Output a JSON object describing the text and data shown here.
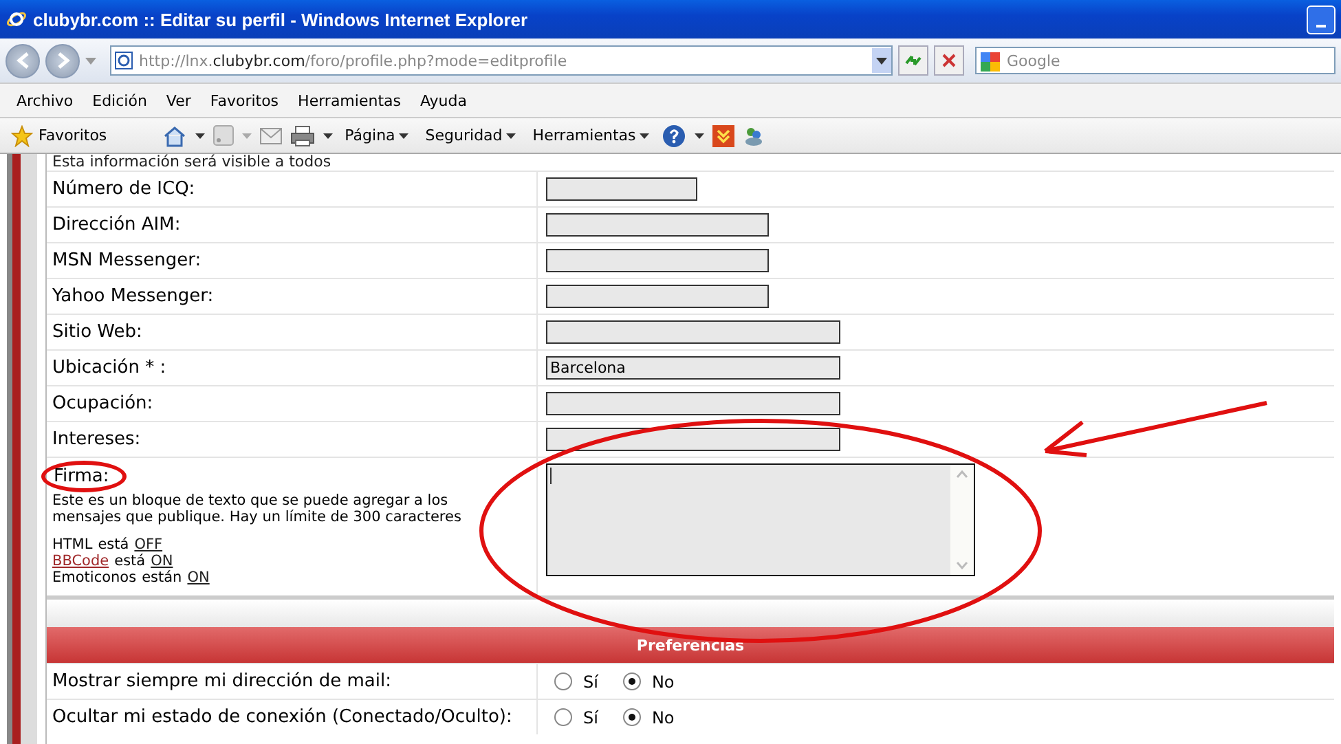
{
  "window": {
    "title": "clubybr.com :: Editar su perfil - Windows Internet Explorer"
  },
  "address": {
    "url_prefix": "http://lnx.",
    "url_domain": "clubybr.com",
    "url_path": "/foro/profile.php?mode=editprofile"
  },
  "search": {
    "placeholder": "Google"
  },
  "menu": [
    "Archivo",
    "Edición",
    "Ver",
    "Favoritos",
    "Herramientas",
    "Ayuda"
  ],
  "toolbar": {
    "favorites": "Favoritos",
    "menus": [
      "Página",
      "Seguridad",
      "Herramientas"
    ]
  },
  "profile": {
    "notice": "Esta información será visible a todos",
    "fields": [
      {
        "label": "Número de ICQ:",
        "kind": "short"
      },
      {
        "label": "Dirección AIM:",
        "kind": "medium"
      },
      {
        "label": "MSN Messenger:",
        "kind": "medium"
      },
      {
        "label": "Yahoo Messenger:",
        "kind": "medium"
      },
      {
        "label": "Sitio Web:",
        "kind": "long"
      },
      {
        "label": "Ubicación * :",
        "kind": "long",
        "value": "Barcelona"
      },
      {
        "label": "Ocupación:",
        "kind": "long"
      },
      {
        "label": "Intereses:",
        "kind": "long"
      }
    ],
    "signature": {
      "label": "Firma:",
      "description": "Este es un bloque de texto que se puede agregar a los mensajes que publique. Hay un límite de 300 caracteres",
      "notes": [
        {
          "name": "HTML",
          "name_link": false,
          "verb": "está",
          "status": "OFF"
        },
        {
          "name": "BBCode",
          "name_link": true,
          "verb": "está",
          "status": "ON"
        },
        {
          "name": "Emoticonos",
          "name_link": false,
          "verb": "están",
          "status": "ON"
        }
      ]
    }
  },
  "preferences": {
    "title": "Preferencias",
    "rows": [
      {
        "label": "Mostrar siempre mi dirección de mail:",
        "options": [
          {
            "label": "Sí",
            "selected": false
          },
          {
            "label": "No",
            "selected": true
          }
        ]
      },
      {
        "label": "Ocultar mi estado de conexión (Conectado/Oculto):",
        "options": [
          {
            "label": "Sí",
            "selected": false
          },
          {
            "label": "No",
            "selected": true
          }
        ]
      }
    ]
  }
}
